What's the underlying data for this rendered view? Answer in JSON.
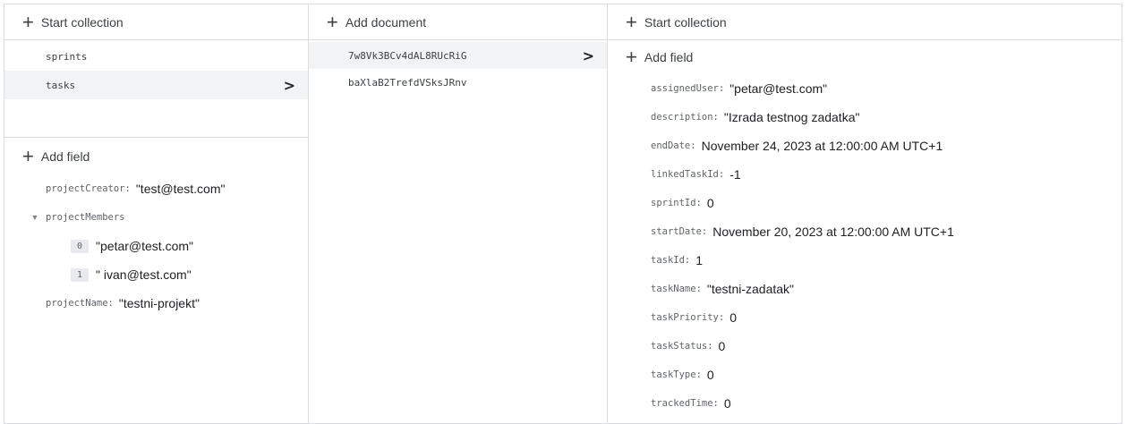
{
  "col1": {
    "start_collection": "Start collection",
    "collections": [
      {
        "name": "sprints"
      },
      {
        "name": "tasks"
      }
    ],
    "add_field": "Add field",
    "project_creator": {
      "key": "projectCreator:",
      "value": "\"test@test.com\""
    },
    "project_members": {
      "key": "projectMembers",
      "items": [
        {
          "index": "0",
          "value": "\"petar@test.com\""
        },
        {
          "index": "1",
          "value": "\" ivan@test.com\""
        }
      ]
    },
    "project_name": {
      "key": "projectName:",
      "value": "\"testni-projekt\""
    }
  },
  "col2": {
    "add_document": "Add document",
    "documents": [
      {
        "id": "7w8Vk3BCv4dAL8RUcRiG"
      },
      {
        "id": "baXlaB2TrefdVSksJRnv"
      }
    ]
  },
  "col3": {
    "start_collection": "Start collection",
    "add_field": "Add field",
    "fields": [
      {
        "key": "assignedUser:",
        "value": "\"petar@test.com\""
      },
      {
        "key": "description:",
        "value": "\"Izrada testnog zadatka\""
      },
      {
        "key": "endDate:",
        "value": "November 24, 2023 at 12:00:00 AM UTC+1"
      },
      {
        "key": "linkedTaskId:",
        "value": "-1"
      },
      {
        "key": "sprintId:",
        "value": "0"
      },
      {
        "key": "startDate:",
        "value": "November 20, 2023 at 12:00:00 AM UTC+1"
      },
      {
        "key": "taskId:",
        "value": "1"
      },
      {
        "key": "taskName:",
        "value": "\"testni-zadatak\""
      },
      {
        "key": "taskPriority:",
        "value": "0"
      },
      {
        "key": "taskStatus:",
        "value": "0"
      },
      {
        "key": "taskType:",
        "value": "0"
      },
      {
        "key": "trackedTime:",
        "value": "0"
      }
    ]
  },
  "icons": {
    "plus": "+",
    "chevron": "›",
    "triangle": "▼"
  }
}
